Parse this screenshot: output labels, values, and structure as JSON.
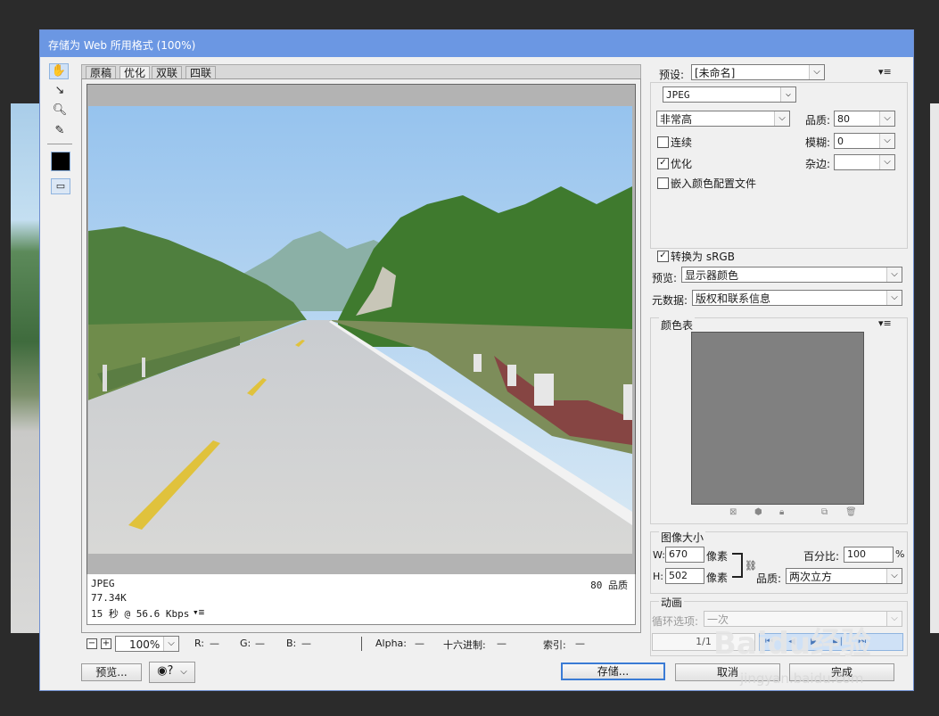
{
  "dialog": {
    "title": "存储为 Web 所用格式 (100%)"
  },
  "tabs": [
    "原稿",
    "优化",
    "双联",
    "四联"
  ],
  "info": {
    "format": "JPEG",
    "size": "77.34K",
    "time": "15 秒 @ 56.6 Kbps",
    "time_menu": "▾≡",
    "quality_readout": "80 品质"
  },
  "status": {
    "zoom": "100%",
    "r_label": "R:",
    "r_val": "—",
    "g_label": "G:",
    "g_val": "—",
    "b_label": "B:",
    "b_val": "—",
    "alpha_label": "Alpha:",
    "alpha_val": "—",
    "hex_label": "十六进制:",
    "hex_val": "—",
    "index_label": "索引:",
    "index_val": "—"
  },
  "buttons": {
    "preview": "预览...",
    "save": "存储...",
    "cancel": "取消",
    "done": "完成"
  },
  "settings": {
    "preset_label": "预设:",
    "preset_value": "[未命名]",
    "format_value": "JPEG",
    "compression_value": "非常高",
    "quality_label": "品质:",
    "quality_value": "80",
    "progressive_label": "连续",
    "blur_label": "模糊:",
    "blur_value": "0",
    "optimized_label": "优化",
    "matte_label": "杂边:",
    "embed_profile_label": "嵌入颜色配置文件",
    "convert_srgb_label": "转换为 sRGB",
    "preview_label": "预览:",
    "preview_value": "显示器颜色",
    "metadata_label": "元数据:",
    "metadata_value": "版权和联系信息"
  },
  "color_table": {
    "title": "颜色表",
    "swatch_color": "#808080"
  },
  "image_size": {
    "title": "图像大小",
    "w_label": "W:",
    "w_value": "670",
    "w_unit": "像素",
    "h_label": "H:",
    "h_value": "502",
    "h_unit": "像素",
    "percent_label": "百分比:",
    "percent_value": "100",
    "percent_unit": "%",
    "quality_label": "品质:",
    "quality_value": "两次立方"
  },
  "animation": {
    "title": "动画",
    "loop_label": "循环选项:",
    "loop_value": "一次",
    "frame_counter": "1/1"
  },
  "watermark": {
    "brand": "Baidu经验",
    "url": "jingyan.baidu.com"
  }
}
